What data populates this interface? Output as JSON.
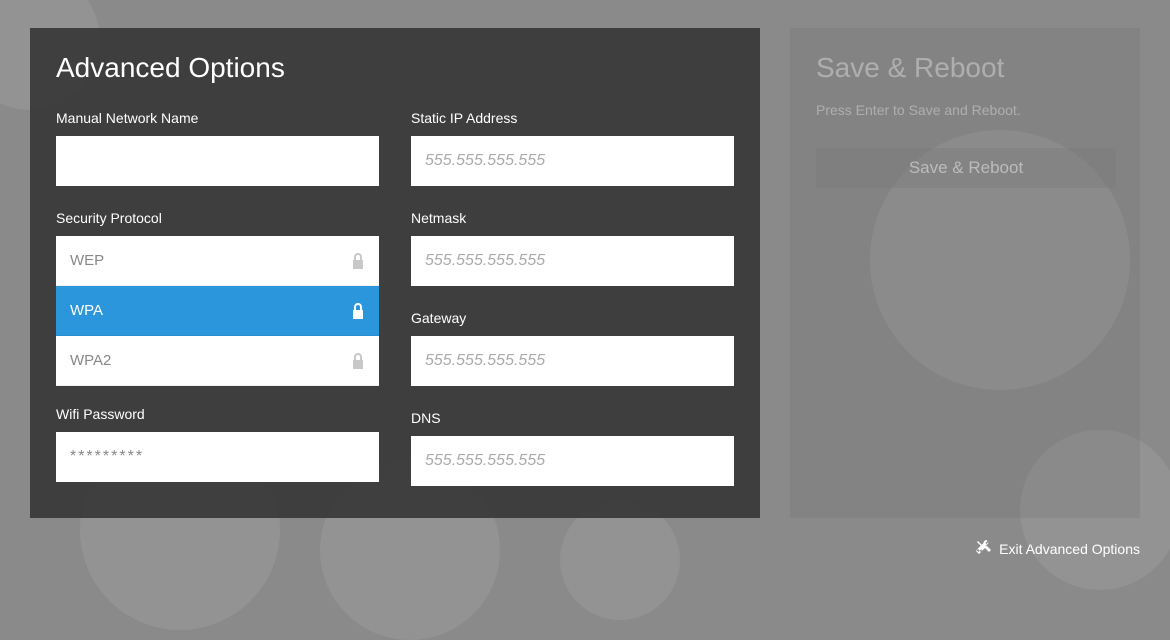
{
  "advanced": {
    "title": "Advanced Options",
    "network_name_label": "Manual Network Name",
    "network_name_value": "",
    "security_label": "Security Protocol",
    "protocols": [
      {
        "label": "WEP",
        "selected": false
      },
      {
        "label": "WPA",
        "selected": true
      },
      {
        "label": "WPA2",
        "selected": false
      }
    ],
    "wifi_password_label": "Wifi Password",
    "wifi_password_placeholder": "*********",
    "static_ip_label": "Static IP Address",
    "static_ip_placeholder": "555.555.555.555",
    "netmask_label": "Netmask",
    "netmask_placeholder": "555.555.555.555",
    "gateway_label": "Gateway",
    "gateway_placeholder": "555.555.555.555",
    "dns_label": "DNS",
    "dns_placeholder": "555.555.555.555"
  },
  "save_panel": {
    "title": "Save & Reboot",
    "subtitle": "Press Enter to Save and Reboot.",
    "button_label": "Save & Reboot"
  },
  "footer": {
    "exit_label": "Exit Advanced Options"
  },
  "colors": {
    "accent": "#2c96dd"
  }
}
